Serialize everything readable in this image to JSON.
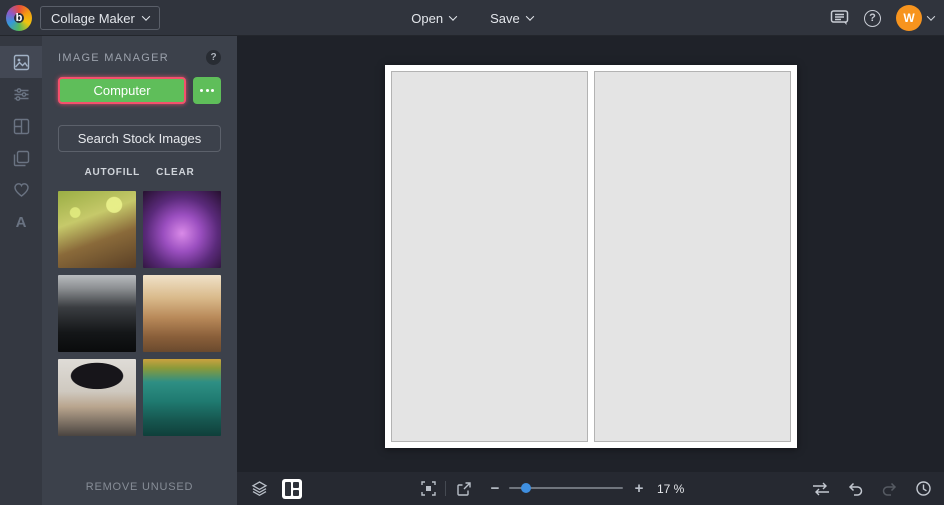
{
  "topbar": {
    "app_menu_label": "Collage Maker",
    "open_label": "Open",
    "save_label": "Save",
    "help_glyph": "?",
    "avatar_initial": "W"
  },
  "left_rail": {
    "text_tool_glyph": "A"
  },
  "image_manager": {
    "title": "IMAGE MANAGER",
    "help_glyph": "?",
    "computer_button_label": "Computer",
    "search_stock_label": "Search Stock Images",
    "autofill_label": "AUTOFILL",
    "clear_label": "CLEAR",
    "remove_unused_label": "REMOVE UNUSED",
    "thumbnails": [
      {
        "name": "woman-portrait-green-bokeh"
      },
      {
        "name": "purple-succulent-flower"
      },
      {
        "name": "vintage-camera"
      },
      {
        "name": "woman-flower-crown"
      },
      {
        "name": "woman-black-hat"
      },
      {
        "name": "teal-vintage-truck"
      }
    ]
  },
  "canvas": {
    "cells": 2
  },
  "bottom_toolbar": {
    "zoom_percent": "17 %"
  },
  "colors": {
    "accent_green": "#5fbe5a",
    "highlight_red": "#f4516c",
    "avatar_orange": "#f7941e",
    "slider_blue": "#3f8fe0"
  }
}
